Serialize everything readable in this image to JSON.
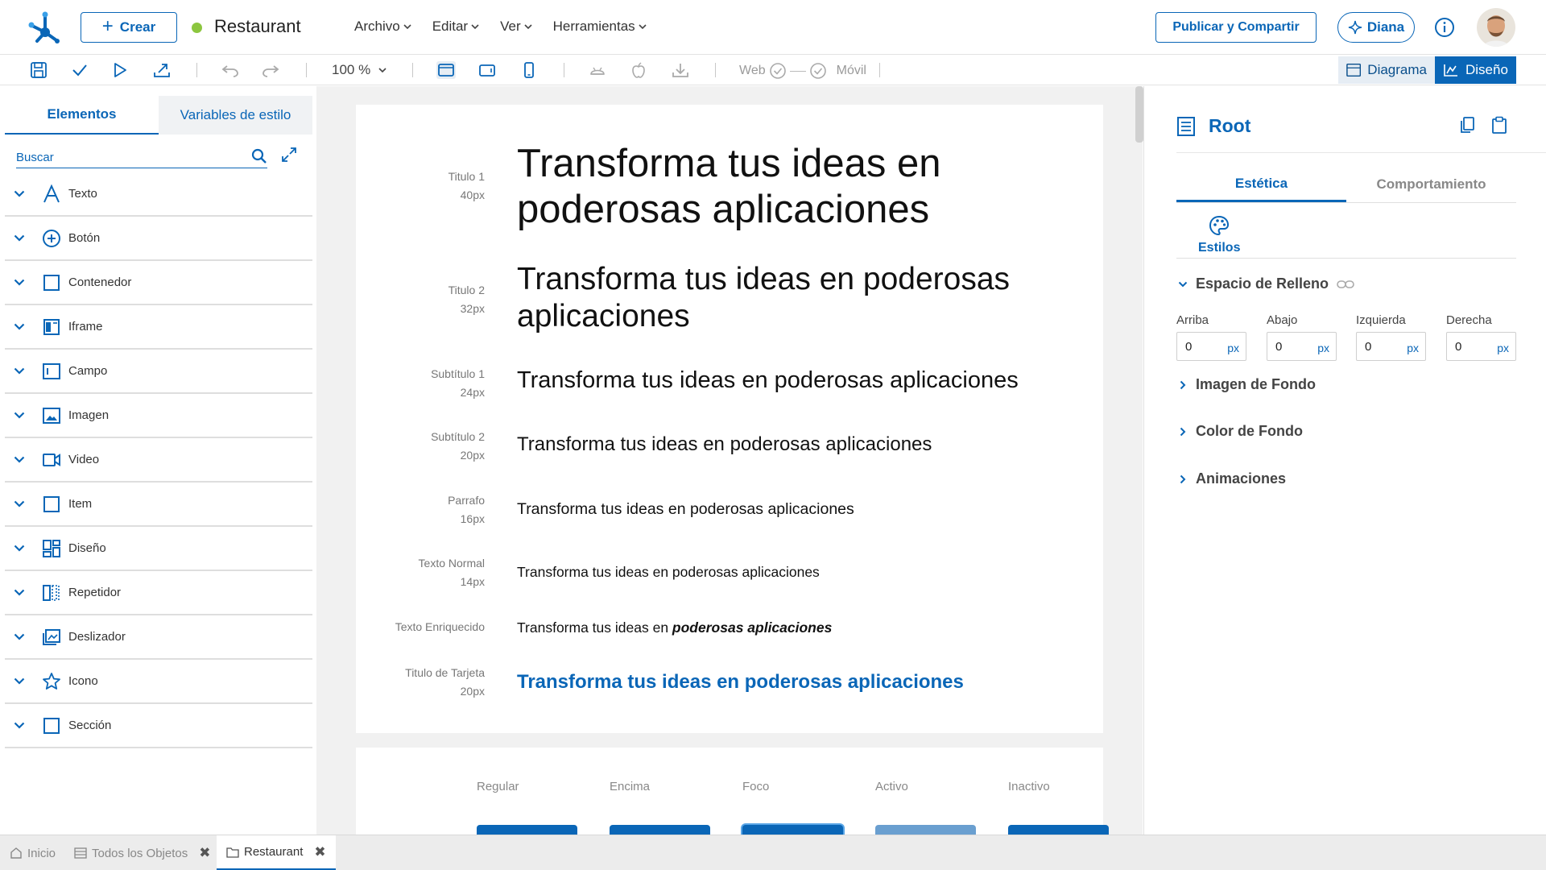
{
  "header": {
    "create_label": "Crear",
    "app_name": "Restaurant",
    "status_color": "#8cc63f",
    "menu": [
      {
        "label": "Archivo"
      },
      {
        "label": "Editar"
      },
      {
        "label": "Ver"
      },
      {
        "label": "Herramientas"
      }
    ],
    "publish_label": "Publicar y Compartir",
    "assistant_label": "Diana",
    "accent_color": "#0a66b7"
  },
  "toolbar": {
    "zoom": "100 %",
    "web_label": "Web",
    "mobile_label": "Móvil",
    "diagram_label": "Diagrama",
    "design_label": "Diseño"
  },
  "left_panel": {
    "tabs": [
      {
        "label": "Elementos",
        "active": true
      },
      {
        "label": "Variables de estilo",
        "active": false
      }
    ],
    "search_placeholder": "Buscar",
    "elements": [
      {
        "label": "Texto",
        "icon": "text-icon"
      },
      {
        "label": "Botón",
        "icon": "add-circle-icon"
      },
      {
        "label": "Contenedor",
        "icon": "square-icon"
      },
      {
        "label": "Iframe",
        "icon": "iframe-icon"
      },
      {
        "label": "Campo",
        "icon": "field-icon"
      },
      {
        "label": "Imagen",
        "icon": "image-icon"
      },
      {
        "label": "Video",
        "icon": "video-icon"
      },
      {
        "label": "Item",
        "icon": "square-icon"
      },
      {
        "label": "Diseño",
        "icon": "layout-icon"
      },
      {
        "label": "Repetidor",
        "icon": "repeater-icon"
      },
      {
        "label": "Deslizador",
        "icon": "slider-icon"
      },
      {
        "label": "Icono",
        "icon": "star-icon"
      },
      {
        "label": "Sección",
        "icon": "square-icon"
      }
    ]
  },
  "canvas": {
    "typography": [
      {
        "name": "Titulo 1",
        "size": "40px",
        "sample": "Transforma tus ideas en poderosas aplicaciones"
      },
      {
        "name": "Titulo 2",
        "size": "32px",
        "sample": "Transforma tus ideas en poderosas aplicaciones"
      },
      {
        "name": "Subtítulo 1",
        "size": "24px",
        "sample": "Transforma tus ideas en poderosas aplicaciones"
      },
      {
        "name": "Subtítulo 2",
        "size": "20px",
        "sample": "Transforma tus ideas en poderosas aplicaciones"
      },
      {
        "name": "Parrafo",
        "size": "16px",
        "sample": "Transforma tus ideas en poderosas aplicaciones"
      },
      {
        "name": "Texto Normal",
        "size": "14px",
        "sample": "Transforma tus ideas en poderosas aplicaciones"
      },
      {
        "name": "Texto Enriquecido",
        "sample_plain": "Transforma tus ideas en ",
        "sample_emphasis": "poderosas aplicaciones"
      },
      {
        "name": "Titulo de Tarjeta",
        "size": "20px",
        "sample": "Transforma tus ideas en poderosas aplicaciones"
      }
    ],
    "button_states": [
      {
        "label": "Regular",
        "color": "#0a66b7"
      },
      {
        "label": "Encima",
        "color": "#0a66b7"
      },
      {
        "label": "Foco",
        "color": "#0a66b7"
      },
      {
        "label": "Activo",
        "color": "#6a9fd0"
      },
      {
        "label": "Inactivo",
        "color": "#0a66b7"
      }
    ]
  },
  "right_panel": {
    "title": "Root",
    "tabs": [
      {
        "label": "Estética",
        "active": true
      },
      {
        "label": "Comportamiento",
        "active": false
      }
    ],
    "styles_label": "Estilos",
    "padding": {
      "title": "Espacio de Relleno",
      "fields": [
        {
          "label": "Arriba",
          "value": "0",
          "unit": "px"
        },
        {
          "label": "Abajo",
          "value": "0",
          "unit": "px"
        },
        {
          "label": "Izquierda",
          "value": "0",
          "unit": "px"
        },
        {
          "label": "Derecha",
          "value": "0",
          "unit": "px"
        }
      ]
    },
    "sections": [
      {
        "label": "Imagen de Fondo"
      },
      {
        "label": "Color de Fondo"
      },
      {
        "label": "Animaciones"
      }
    ]
  },
  "bottom_tabs": [
    {
      "label": "Inicio",
      "icon": "home-icon"
    },
    {
      "label": "Todos los Objetos",
      "icon": "list-icon"
    },
    {
      "label": "Restaurant",
      "icon": "folder-icon"
    }
  ]
}
